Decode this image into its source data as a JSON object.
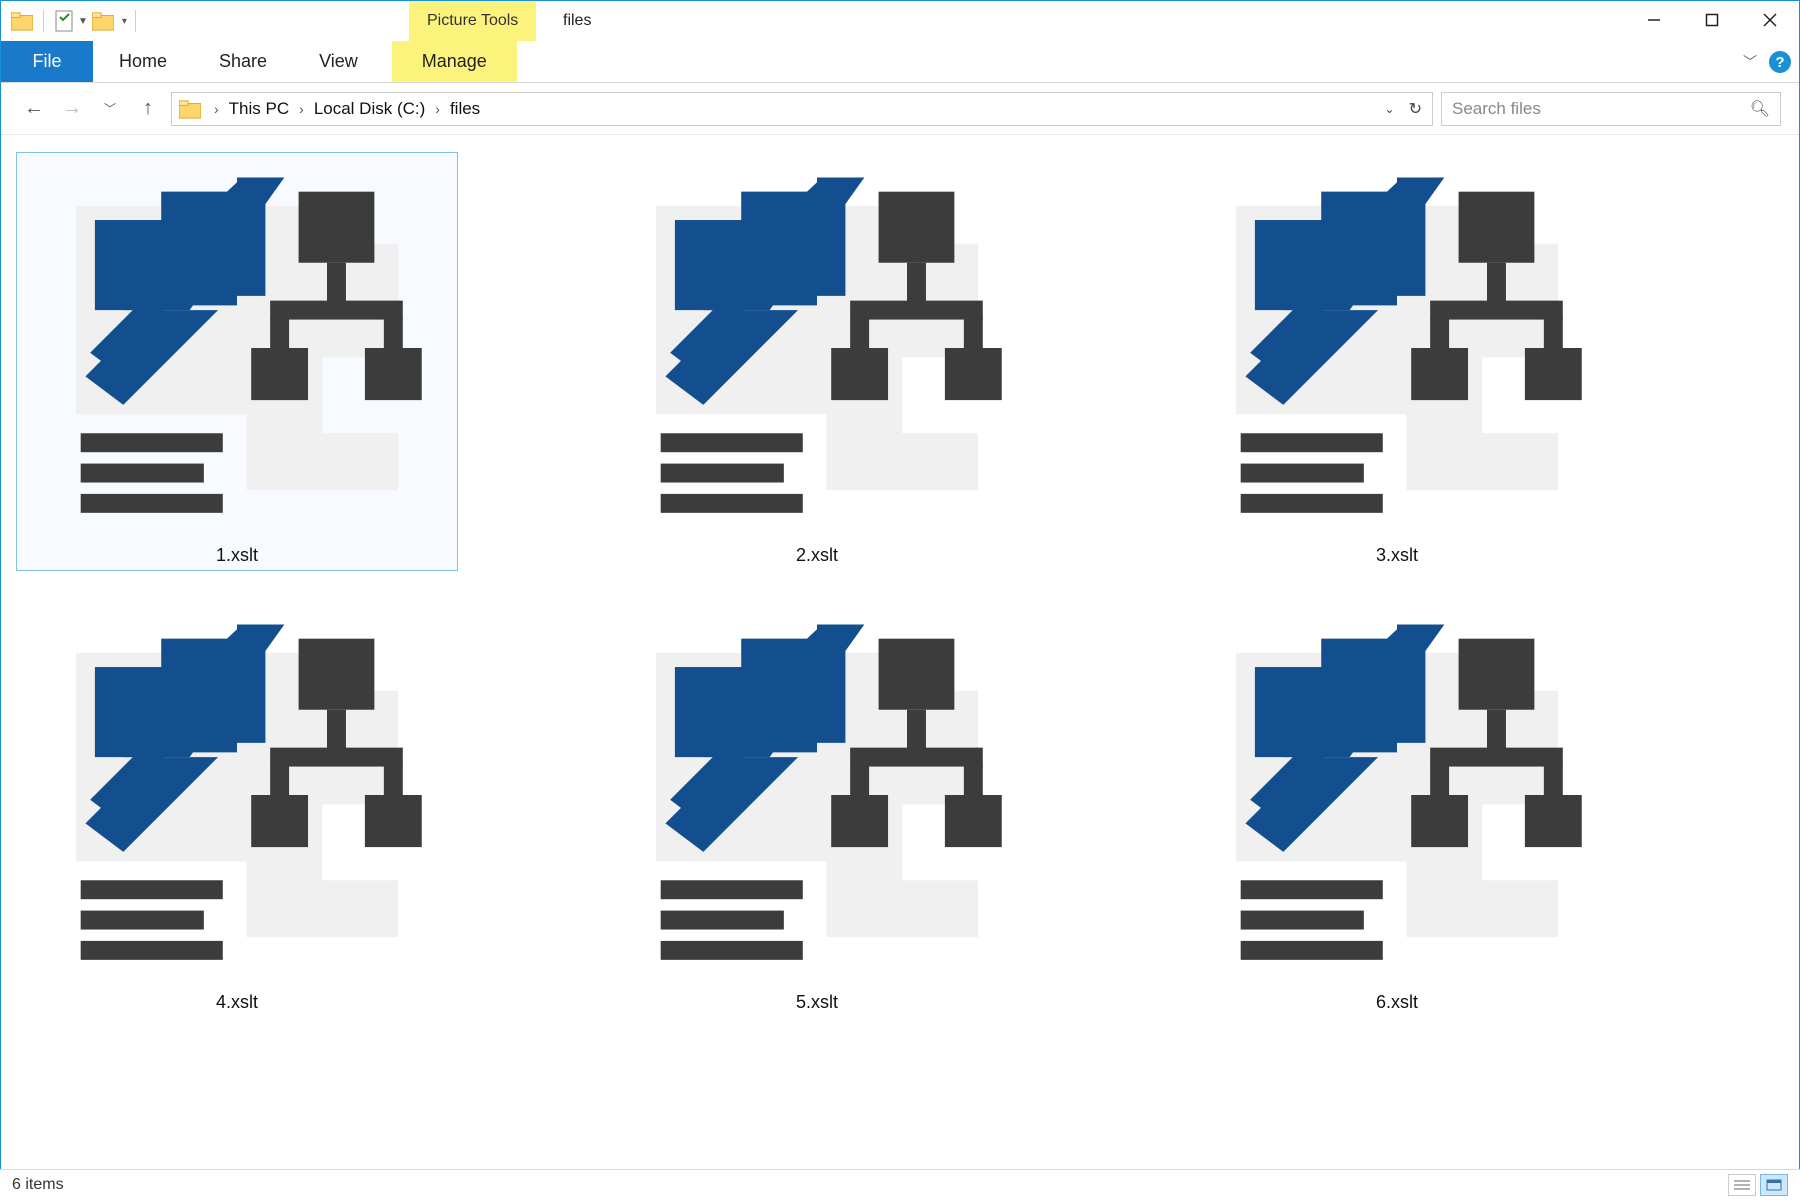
{
  "titlebar": {
    "tools_context_label": "Picture Tools",
    "window_title": "files"
  },
  "ribbon": {
    "file_label": "File",
    "tabs": [
      "Home",
      "Share",
      "View"
    ],
    "tools_tab_label": "Manage"
  },
  "address": {
    "crumbs": [
      "This PC",
      "Local Disk (C:)",
      "files"
    ]
  },
  "search": {
    "placeholder": "Search files"
  },
  "files": [
    {
      "name": "1.xslt",
      "selected": true
    },
    {
      "name": "2.xslt",
      "selected": false
    },
    {
      "name": "3.xslt",
      "selected": false
    },
    {
      "name": "4.xslt",
      "selected": false
    },
    {
      "name": "5.xslt",
      "selected": false
    },
    {
      "name": "6.xslt",
      "selected": false
    }
  ],
  "status": {
    "count_label": "6 items"
  }
}
